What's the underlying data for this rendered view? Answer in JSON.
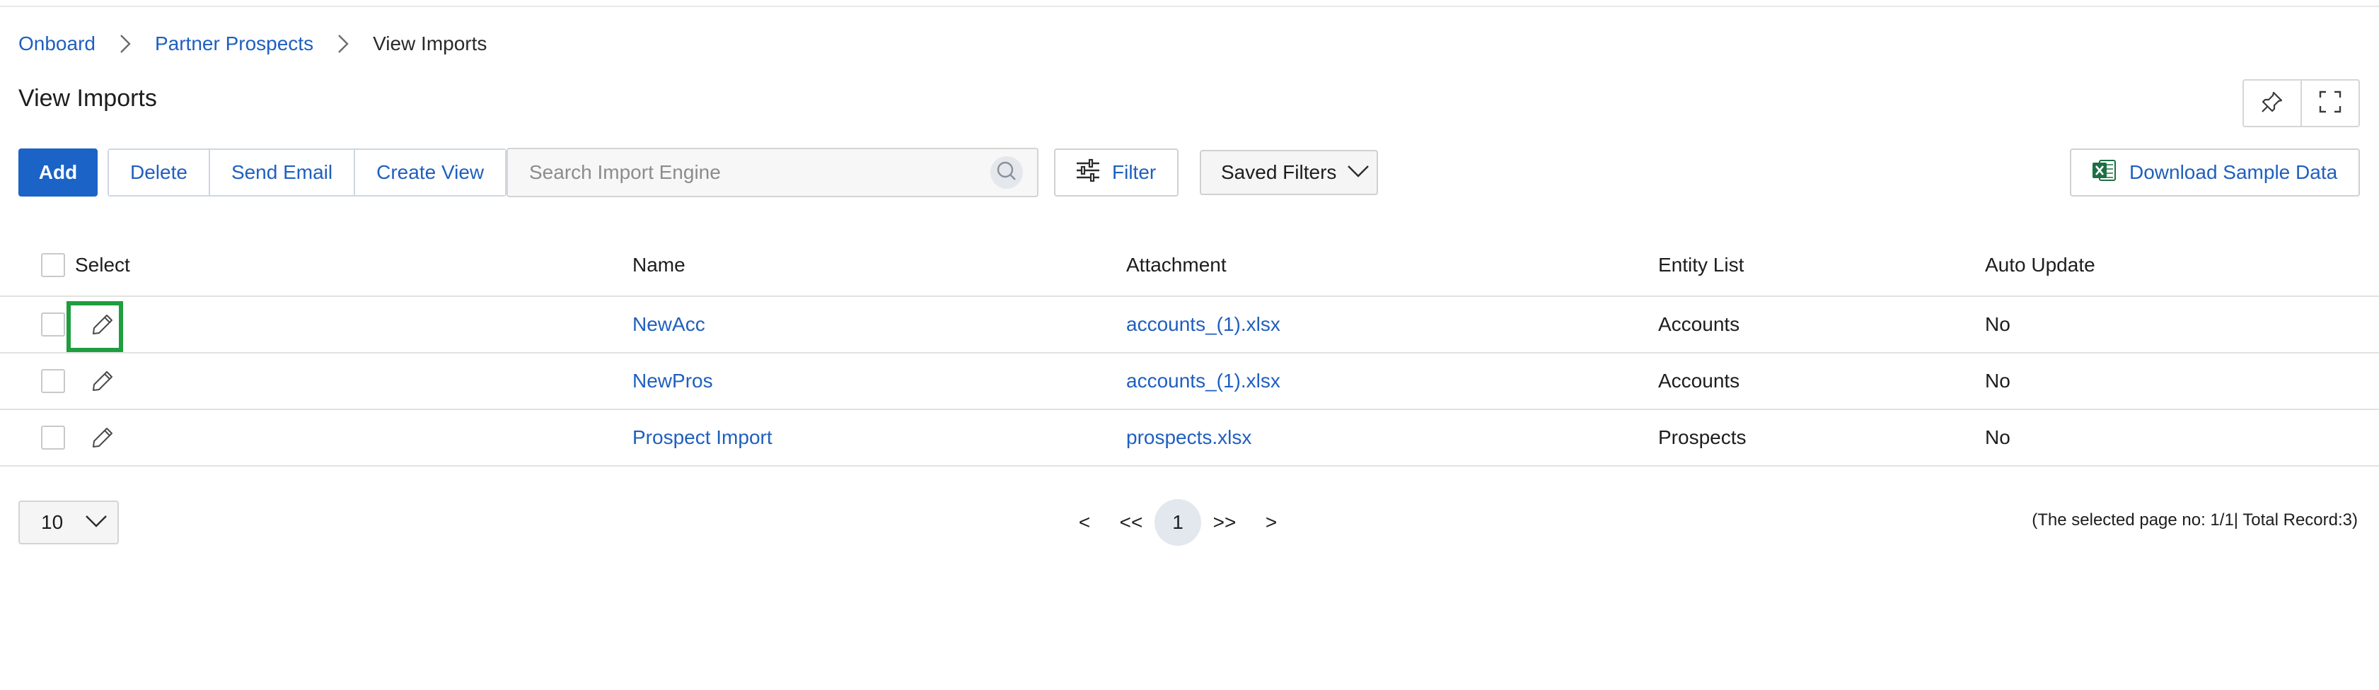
{
  "breadcrumb": {
    "items": [
      "Onboard",
      "Partner Prospects"
    ],
    "current": "View Imports"
  },
  "page": {
    "title": "View Imports"
  },
  "toolbar": {
    "add_label": "Add",
    "delete_label": "Delete",
    "send_email_label": "Send Email",
    "create_view_label": "Create View",
    "search_placeholder": "Search Import Engine",
    "search_value": "",
    "filter_label": "Filter",
    "saved_filters_label": "Saved Filters",
    "download_label": "Download Sample Data"
  },
  "table": {
    "columns": [
      "Select",
      "Name",
      "Attachment",
      "Entity List",
      "Auto Update"
    ],
    "rows": [
      {
        "name": "NewAcc",
        "attachment": "accounts_(1).xlsx",
        "entity": "Accounts",
        "auto_update": "No"
      },
      {
        "name": "NewPros",
        "attachment": "accounts_(1).xlsx",
        "entity": "Accounts",
        "auto_update": "No"
      },
      {
        "name": "Prospect Import",
        "attachment": "prospects.xlsx",
        "entity": "Prospects",
        "auto_update": "No"
      }
    ]
  },
  "pagination": {
    "page_size": "10",
    "prev": "<",
    "first": "<<",
    "current_page": "1",
    "last": ">>",
    "next": ">",
    "info": "(The selected page no: 1/1| Total Record:3)"
  },
  "icons": {
    "breadcrumb_separator": "chevron-right-icon",
    "pin": "pin-icon",
    "fullscreen": "fullscreen-icon",
    "search": "search-icon",
    "filter": "sliders-icon",
    "dropdown": "chevron-down-icon",
    "excel": "excel-icon",
    "edit": "pencil-icon"
  },
  "colors": {
    "primary": "#1b63c6",
    "link": "#1f5fbf",
    "highlight": "#1e9e3e",
    "excel_green": "#1d7044"
  }
}
